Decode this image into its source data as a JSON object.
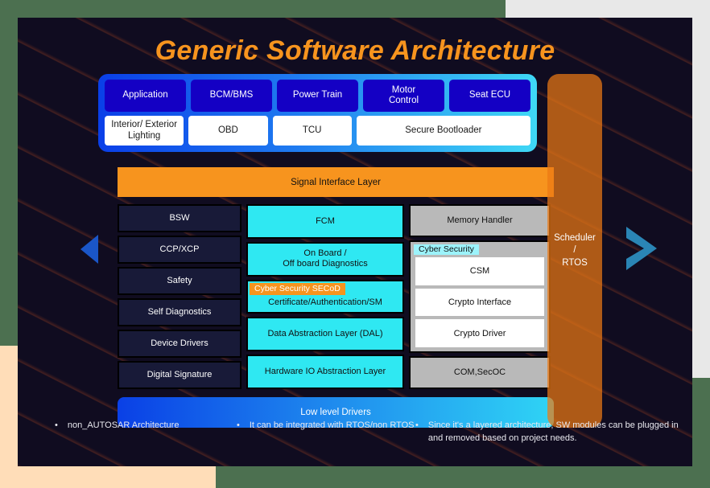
{
  "slide": {
    "title": "Generic Software Architecture"
  },
  "application_layer": {
    "row1": [
      {
        "label": "Application"
      },
      {
        "label": "BCM/BMS"
      },
      {
        "label": "Power Train"
      },
      {
        "label": "Motor\nControl"
      },
      {
        "label": "Seat  ECU"
      }
    ],
    "row2": [
      {
        "label": "Interior/ Exterior\nLighting",
        "flex": 1
      },
      {
        "label": "OBD",
        "flex": 1
      },
      {
        "label": "TCU",
        "flex": 1
      },
      {
        "label": "Secure Bootloader",
        "flex": 2.2
      }
    ]
  },
  "signal_layer": {
    "label": "Signal Interface Layer"
  },
  "columns": {
    "left": [
      {
        "label": "BSW"
      },
      {
        "label": "CCP/XCP"
      },
      {
        "label": "Safety"
      },
      {
        "label": "Self Diagnostics"
      },
      {
        "label": "Device Drivers"
      },
      {
        "label": "Digital Signature"
      }
    ],
    "middle": [
      {
        "label": "FCM"
      },
      {
        "label": "On Board /\nOff board Diagnostics"
      },
      {
        "tag": "Cyber Security SECoD",
        "label": "Certificate/Authentication/SM"
      },
      {
        "label": "Data Abstraction Layer (DAL)"
      },
      {
        "label": "Hardware IO Abstraction Layer"
      }
    ],
    "right": {
      "top": {
        "label": "Memory Handler"
      },
      "group": {
        "tag": "Cyber Security",
        "items": [
          {
            "label": "CSM"
          },
          {
            "label": "Crypto Interface"
          },
          {
            "label": "Crypto Driver"
          }
        ]
      },
      "bottom": {
        "label": "COM,SecOC"
      }
    }
  },
  "low_level_drivers": {
    "label": "Low level Drivers"
  },
  "scheduler": {
    "label": "Scheduler\n/\nRTOS"
  },
  "bullets": [
    {
      "marker": "•",
      "text": "non_AUTOSAR Architecture"
    },
    {
      "marker": "•",
      "text": "It can be integrated with RTOS/non RTOS"
    },
    {
      "marker": "•",
      "text": "Since it's a layered architecture, SW  modules can be plugged in and removed based on project needs."
    }
  ],
  "colors": {
    "accent_orange": "#f7941e",
    "cyan": "#2fe8f2",
    "navy_cell": "#181a38",
    "gray_cell": "#b9b9b9",
    "ecu_blue": "#1400c4",
    "arrow_left": "#1a56c8",
    "arrow_right": "#2a85b5"
  }
}
